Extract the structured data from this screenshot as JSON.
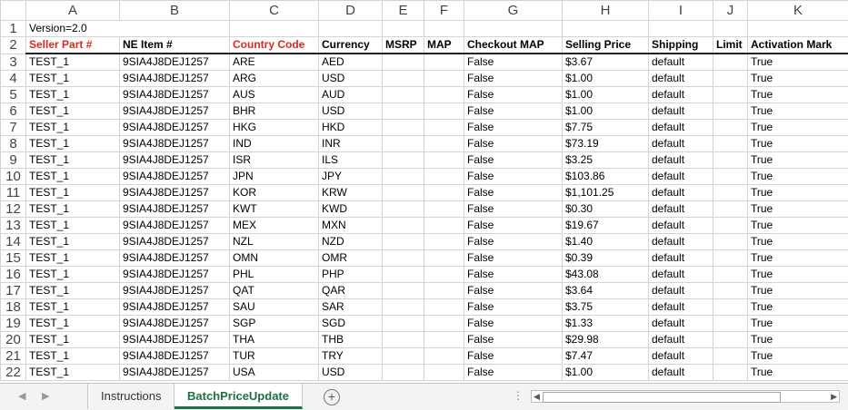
{
  "columns": [
    "A",
    "B",
    "C",
    "D",
    "E",
    "F",
    "G",
    "H",
    "I",
    "J",
    "K"
  ],
  "version_row": {
    "num": "1",
    "text": "Version=2.0"
  },
  "header_row": {
    "num": "2",
    "cells": [
      "Seller Part #",
      "NE Item #",
      "Country Code",
      "Currency",
      "MSRP",
      "MAP",
      "Checkout MAP",
      "Selling Price",
      "Shipping",
      "Limit",
      "Activation Mark"
    ]
  },
  "rows": [
    {
      "num": "3",
      "cells": [
        "TEST_1",
        "9SIA4J8DEJ1257",
        "ARE",
        "AED",
        "",
        "",
        "False",
        "$3.67",
        "default",
        "",
        "True"
      ]
    },
    {
      "num": "4",
      "cells": [
        "TEST_1",
        "9SIA4J8DEJ1257",
        "ARG",
        "USD",
        "",
        "",
        "False",
        "$1.00",
        "default",
        "",
        "True"
      ]
    },
    {
      "num": "5",
      "cells": [
        "TEST_1",
        "9SIA4J8DEJ1257",
        "AUS",
        "AUD",
        "",
        "",
        "False",
        "$1.00",
        "default",
        "",
        "True"
      ]
    },
    {
      "num": "6",
      "cells": [
        "TEST_1",
        "9SIA4J8DEJ1257",
        "BHR",
        "USD",
        "",
        "",
        "False",
        "$1.00",
        "default",
        "",
        "True"
      ]
    },
    {
      "num": "7",
      "cells": [
        "TEST_1",
        "9SIA4J8DEJ1257",
        "HKG",
        "HKD",
        "",
        "",
        "False",
        "$7.75",
        "default",
        "",
        "True"
      ]
    },
    {
      "num": "8",
      "cells": [
        "TEST_1",
        "9SIA4J8DEJ1257",
        "IND",
        "INR",
        "",
        "",
        "False",
        "$73.19",
        "default",
        "",
        "True"
      ]
    },
    {
      "num": "9",
      "cells": [
        "TEST_1",
        "9SIA4J8DEJ1257",
        "ISR",
        "ILS",
        "",
        "",
        "False",
        "$3.25",
        "default",
        "",
        "True"
      ]
    },
    {
      "num": "10",
      "cells": [
        "TEST_1",
        "9SIA4J8DEJ1257",
        "JPN",
        "JPY",
        "",
        "",
        "False",
        "$103.86",
        "default",
        "",
        "True"
      ]
    },
    {
      "num": "11",
      "cells": [
        "TEST_1",
        "9SIA4J8DEJ1257",
        "KOR",
        "KRW",
        "",
        "",
        "False",
        "$1,101.25",
        "default",
        "",
        "True"
      ]
    },
    {
      "num": "12",
      "cells": [
        "TEST_1",
        "9SIA4J8DEJ1257",
        "KWT",
        "KWD",
        "",
        "",
        "False",
        "$0.30",
        "default",
        "",
        "True"
      ]
    },
    {
      "num": "13",
      "cells": [
        "TEST_1",
        "9SIA4J8DEJ1257",
        "MEX",
        "MXN",
        "",
        "",
        "False",
        "$19.67",
        "default",
        "",
        "True"
      ]
    },
    {
      "num": "14",
      "cells": [
        "TEST_1",
        "9SIA4J8DEJ1257",
        "NZL",
        "NZD",
        "",
        "",
        "False",
        "$1.40",
        "default",
        "",
        "True"
      ]
    },
    {
      "num": "15",
      "cells": [
        "TEST_1",
        "9SIA4J8DEJ1257",
        "OMN",
        "OMR",
        "",
        "",
        "False",
        "$0.39",
        "default",
        "",
        "True"
      ]
    },
    {
      "num": "16",
      "cells": [
        "TEST_1",
        "9SIA4J8DEJ1257",
        "PHL",
        "PHP",
        "",
        "",
        "False",
        "$43.08",
        "default",
        "",
        "True"
      ]
    },
    {
      "num": "17",
      "cells": [
        "TEST_1",
        "9SIA4J8DEJ1257",
        "QAT",
        "QAR",
        "",
        "",
        "False",
        "$3.64",
        "default",
        "",
        "True"
      ]
    },
    {
      "num": "18",
      "cells": [
        "TEST_1",
        "9SIA4J8DEJ1257",
        "SAU",
        "SAR",
        "",
        "",
        "False",
        "$3.75",
        "default",
        "",
        "True"
      ]
    },
    {
      "num": "19",
      "cells": [
        "TEST_1",
        "9SIA4J8DEJ1257",
        "SGP",
        "SGD",
        "",
        "",
        "False",
        "$1.33",
        "default",
        "",
        "True"
      ]
    },
    {
      "num": "20",
      "cells": [
        "TEST_1",
        "9SIA4J8DEJ1257",
        "THA",
        "THB",
        "",
        "",
        "False",
        "$29.98",
        "default",
        "",
        "True"
      ]
    },
    {
      "num": "21",
      "cells": [
        "TEST_1",
        "9SIA4J8DEJ1257",
        "TUR",
        "TRY",
        "",
        "",
        "False",
        "$7.47",
        "default",
        "",
        "True"
      ]
    },
    {
      "num": "22",
      "cells": [
        "TEST_1",
        "9SIA4J8DEJ1257",
        "USA",
        "USD",
        "",
        "",
        "False",
        "$1.00",
        "default",
        "",
        "True"
      ]
    }
  ],
  "red_header_columns": [
    0,
    2
  ],
  "tabs": [
    {
      "label": "Instructions",
      "active": false
    },
    {
      "label": "BatchPriceUpdate",
      "active": true
    }
  ],
  "colors": {
    "red_header": "#e0271f",
    "active_tab": "#1e7145"
  }
}
